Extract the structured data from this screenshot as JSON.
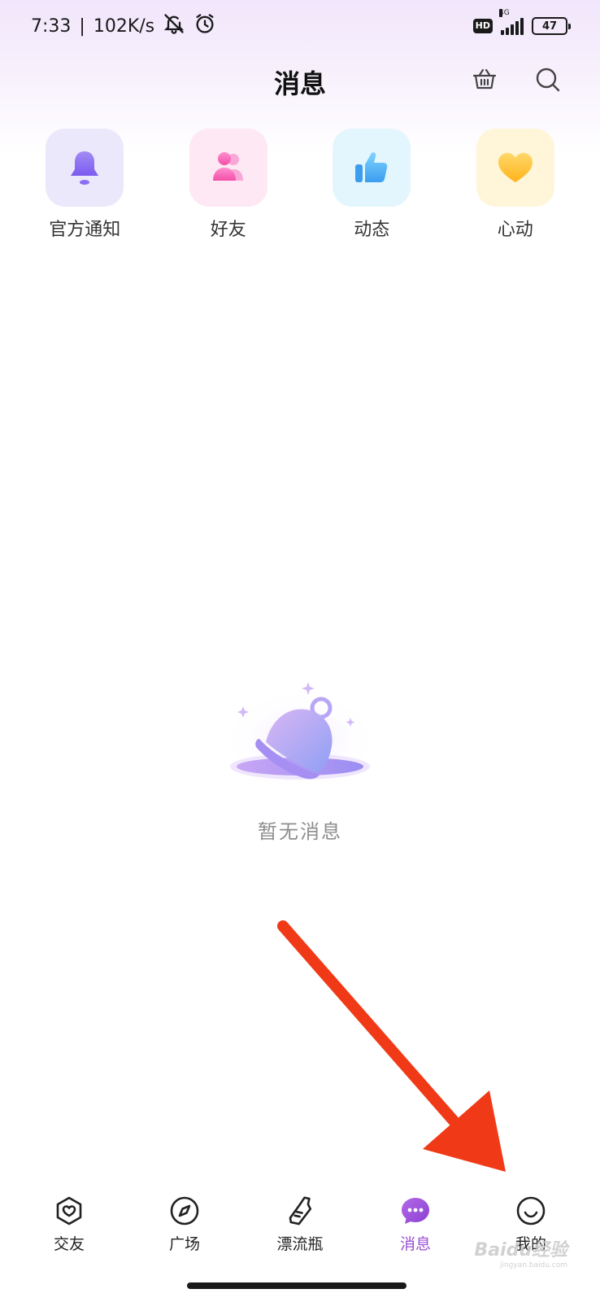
{
  "status_bar": {
    "time": "7:33",
    "network_speed": "102K/s",
    "hd_label": "HD",
    "network_type": "4G",
    "battery_level": "47",
    "icons": [
      "silent-bell-icon",
      "alarm-clock-icon",
      "signal-icon",
      "battery-icon"
    ]
  },
  "header": {
    "title": "消息",
    "icons": [
      "basket-icon",
      "search-icon"
    ]
  },
  "entries": [
    {
      "label": "官方通知",
      "icon": "bell-icon",
      "bg": "#ece8fb"
    },
    {
      "label": "好友",
      "icon": "friends-icon",
      "bg": "#fde8f4"
    },
    {
      "label": "动态",
      "icon": "thumbs-up-icon",
      "bg": "#e3f6fd"
    },
    {
      "label": "心动",
      "icon": "heart-icon",
      "bg": "#fff5d9"
    }
  ],
  "empty_state": {
    "text": "暂无消息",
    "icon": "bell-illustration-icon"
  },
  "tabbar": {
    "tabs": [
      {
        "label": "交友",
        "icon": "heart-home-icon",
        "active": false
      },
      {
        "label": "广场",
        "icon": "compass-icon",
        "active": false
      },
      {
        "label": "漂流瓶",
        "icon": "bottle-icon",
        "active": false
      },
      {
        "label": "消息",
        "icon": "chat-bubble-icon",
        "active": true
      },
      {
        "label": "我的",
        "icon": "smile-face-icon",
        "active": false
      }
    ]
  },
  "watermark": {
    "text": "Baidu经验",
    "sub": "jingyan.baidu.com"
  },
  "colors": {
    "accent": "#9a4fd6",
    "annotation_arrow": "#f03a17"
  }
}
